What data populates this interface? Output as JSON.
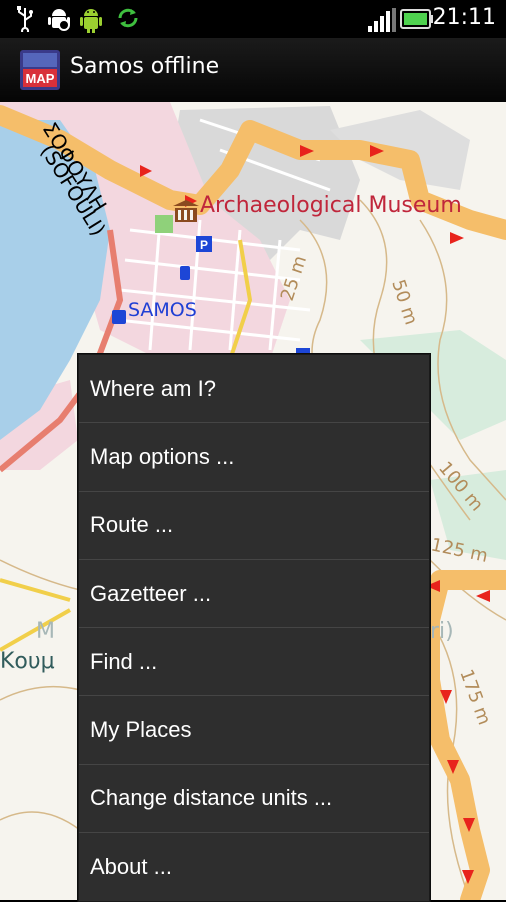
{
  "status_bar": {
    "time": "21:11",
    "icons": [
      "usb-icon",
      "android-debug-icon",
      "android-icon",
      "sync-icon",
      "signal-icon",
      "battery-icon"
    ]
  },
  "app": {
    "title": "Samos offline",
    "icon_text": "MAP"
  },
  "map": {
    "labels": {
      "street_greek": "ΣΟΦΟΥΛΗ",
      "street_latin": "(SOFOULI)",
      "museum": "Archaeological Museum",
      "town": "SAMOS",
      "contour_25": "25 m",
      "contour_50": "50 m",
      "contour_100": "100 m",
      "contour_125": "125 m",
      "contour_175": "175 m",
      "partial_left_1": "Μ",
      "partial_left_2": "Κουμ",
      "partial_right": "ri)"
    },
    "colors": {
      "sea": "#a8cfe9",
      "route": "#f5be6a",
      "route_arrow": "#e8231c",
      "urban": "#f3d7df",
      "built": "#d9d9d9",
      "museum_text": "#c0263b",
      "town_text": "#1f3fd4"
    }
  },
  "menu": {
    "items": [
      {
        "label": "Where am I?"
      },
      {
        "label": "Map options ..."
      },
      {
        "label": "Route ..."
      },
      {
        "label": "Gazetteer ..."
      },
      {
        "label": "Find ..."
      },
      {
        "label": "My Places"
      },
      {
        "label": "Change distance units ..."
      },
      {
        "label": "About ..."
      }
    ]
  }
}
